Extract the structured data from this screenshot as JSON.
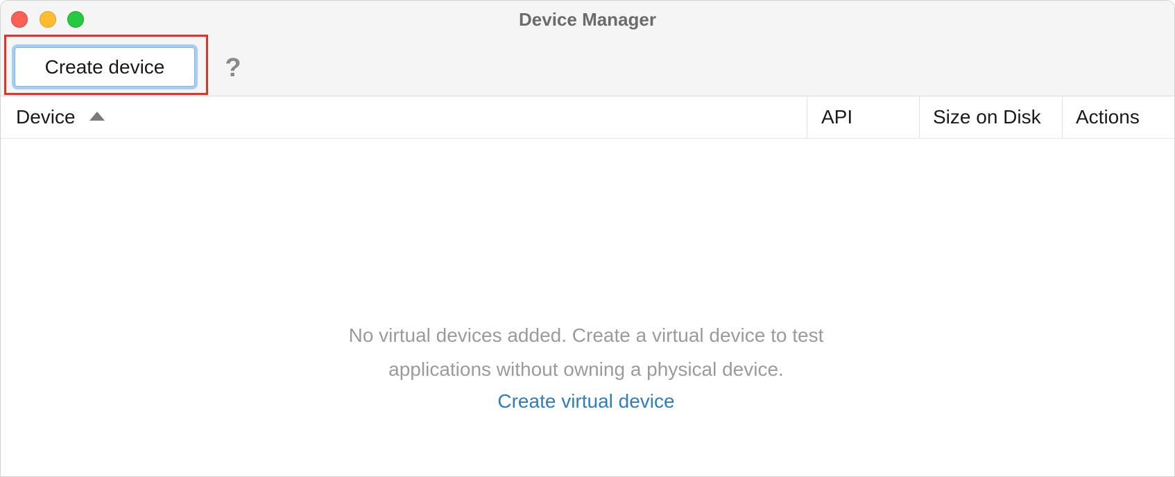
{
  "window": {
    "title": "Device Manager"
  },
  "toolbar": {
    "create_device_label": "Create device",
    "help_label": "?"
  },
  "table": {
    "columns": [
      "Device",
      "API",
      "Size on Disk",
      "Actions"
    ],
    "sort_column": "Device",
    "sort_direction": "ascending"
  },
  "empty_state": {
    "message_line1": "No virtual devices added. Create a virtual device to test",
    "message_line2": "applications without owning a physical device.",
    "link_label": "Create virtual device"
  },
  "colors": {
    "highlight": "#e8321f",
    "link": "#2f7dbf",
    "button_focus": "#a8cdf3"
  },
  "icons": {
    "close": "close-window-icon",
    "minimize": "minimize-window-icon",
    "maximize": "maximize-window-icon",
    "help": "help-icon",
    "sort": "sort-ascending-icon"
  }
}
